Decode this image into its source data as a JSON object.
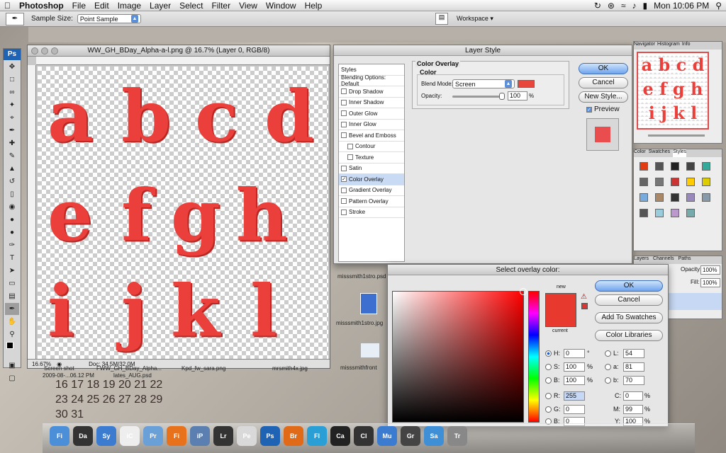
{
  "menubar": {
    "app": "Photoshop",
    "items": [
      "File",
      "Edit",
      "Image",
      "Layer",
      "Select",
      "Filter",
      "View",
      "Window",
      "Help"
    ],
    "clock": "Mon 10:06 PM"
  },
  "options": {
    "sample_label": "Sample Size:",
    "sample_value": "Point Sample",
    "workspace": "Workspace ▾"
  },
  "document": {
    "title": "WW_GH_BDay_Alpha-a-l.png @ 16.7% (Layer 0, RGB/8)",
    "letters": [
      "a",
      "b",
      "c",
      "d",
      "e",
      "f",
      "g",
      "h",
      "i",
      "j",
      "k",
      "l"
    ],
    "zoom": "16.67%",
    "doc_info": "Doc: 34.5M/32.0M"
  },
  "layer_style": {
    "title": "Layer Style",
    "list": [
      {
        "label": "Styles",
        "checkbox": false,
        "checked": false
      },
      {
        "label": "Blending Options: Default",
        "checkbox": false,
        "checked": false
      },
      {
        "label": "Drop Shadow",
        "checkbox": true,
        "checked": false
      },
      {
        "label": "Inner Shadow",
        "checkbox": true,
        "checked": false
      },
      {
        "label": "Outer Glow",
        "checkbox": true,
        "checked": false
      },
      {
        "label": "Inner Glow",
        "checkbox": true,
        "checked": false
      },
      {
        "label": "Bevel and Emboss",
        "checkbox": true,
        "checked": false
      },
      {
        "label": "Contour",
        "checkbox": true,
        "checked": false
      },
      {
        "label": "Texture",
        "checkbox": true,
        "checked": false
      },
      {
        "label": "Satin",
        "checkbox": true,
        "checked": false
      },
      {
        "label": "Color Overlay",
        "checkbox": true,
        "checked": true
      },
      {
        "label": "Gradient Overlay",
        "checkbox": true,
        "checked": false
      },
      {
        "label": "Pattern Overlay",
        "checkbox": true,
        "checked": false
      },
      {
        "label": "Stroke",
        "checkbox": true,
        "checked": false
      }
    ],
    "section_title": "Color Overlay",
    "sub_title": "Color",
    "blend_label": "Blend Mode:",
    "blend_value": "Screen",
    "opacity_label": "Opacity:",
    "opacity_value": "100",
    "opacity_unit": "%",
    "ok": "OK",
    "cancel": "Cancel",
    "new_style": "New Style...",
    "preview": "Preview",
    "overlay_color": "#e8453d"
  },
  "navigator": {
    "tabs": [
      "Navigator",
      "Histogram",
      "Info"
    ],
    "rows": [
      "a b c d",
      "e f g h",
      "i j k l"
    ]
  },
  "styles_panel": {
    "tabs": [
      "Color",
      "Swatches",
      "Styles"
    ]
  },
  "layers_panel": {
    "tabs": [
      "Layers",
      "Channels",
      "Paths"
    ],
    "opacity_label": "Opacity:",
    "opacity_value": "100%",
    "fill_label": "Fill:",
    "fill_value": "100%"
  },
  "color_picker": {
    "title": "Select overlay color:",
    "new_label": "new",
    "current_label": "current",
    "ok": "OK",
    "cancel": "Cancel",
    "add_swatches": "Add To Swatches",
    "color_libraries": "Color Libraries",
    "hsb": {
      "H": "0",
      "S": "100",
      "B": "100"
    },
    "rgb": {
      "R": "255",
      "G": "0",
      "B": "0"
    },
    "lab": {
      "L": "54",
      "a": "81",
      "b": "70"
    },
    "cmyk": {
      "C": "0",
      "M": "99",
      "Y": "100"
    },
    "deg": "°",
    "pct": "%",
    "swatch_color": "#e8392f"
  },
  "desktop": {
    "labels": [
      "misssmith1stro.psd",
      "misssmith1stro.jpg",
      "misssmithfront",
      "Screen shot",
      "2009-08-...06.12 PM",
      "FWW_GH_BDay_Alpha...",
      "lates_AUG.psd",
      "Kpd_fw_sara.png",
      "mrsmith4x.jpg"
    ],
    "calendar_rows": [
      "16 17   18 19 20 21 22",
      "23 24   25 26 27 28 29",
      "30 31"
    ]
  },
  "dock": {
    "items": [
      "Finder",
      "Dashboard",
      "Sync",
      "iCal",
      "Preview",
      "Firefox",
      "iPhoto",
      "Lr",
      "Pen",
      "Ps",
      "Br",
      "Flip",
      "Calc",
      "Clapper",
      "Music",
      "Grid",
      "Safari",
      "Trash"
    ]
  }
}
